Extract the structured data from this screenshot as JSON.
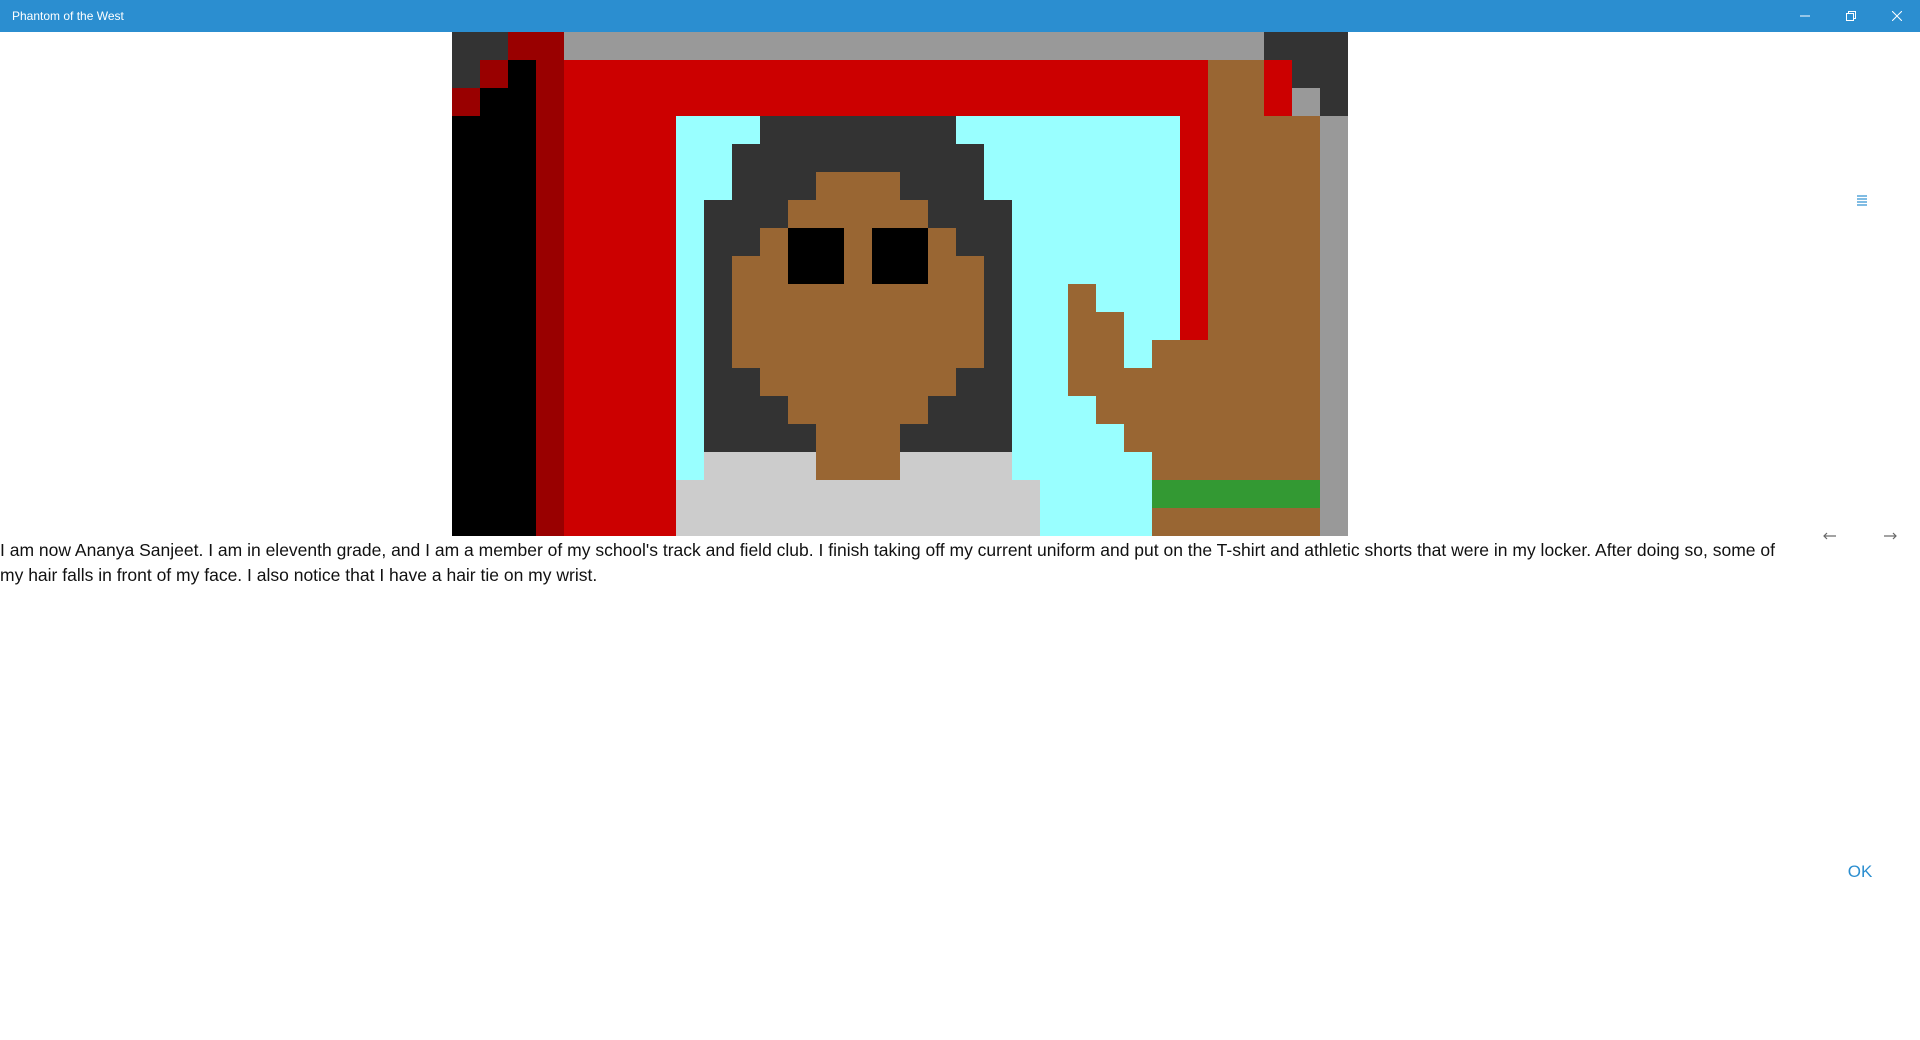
{
  "window": {
    "title": "Phantom of the West"
  },
  "titlebar_buttons": [
    {
      "name": "minimize",
      "icon": "minimize-icon"
    },
    {
      "name": "restore",
      "icon": "restore-icon"
    },
    {
      "name": "close",
      "icon": "close-icon"
    }
  ],
  "scene": {
    "description_icon": "pixel-art-portrait",
    "palette": {
      "dark_gray": "#333333",
      "gray": "#999999",
      "light_gray": "#cccccc",
      "red": "#cc0000",
      "dark_red": "#990000",
      "black": "#000000",
      "cyan": "#99ffff",
      "brown": "#996633",
      "green": "#339933"
    }
  },
  "story": {
    "text": "I am now Ananya Sanjeet. I am in eleventh grade, and I am a member of my school's track and field club. I finish taking off my current uniform and put on the T-shirt and athletic shorts that were in my locker. After doing so, some of my hair falls in front of my face. I also notice that I have a hair tie on my wrist."
  },
  "controls": {
    "menu_icon": "hamburger-menu-icon",
    "back_icon": "arrow-left-icon",
    "forward_icon": "arrow-right-icon",
    "ok_label": "OK",
    "accent_color": "#2b8ed0"
  }
}
